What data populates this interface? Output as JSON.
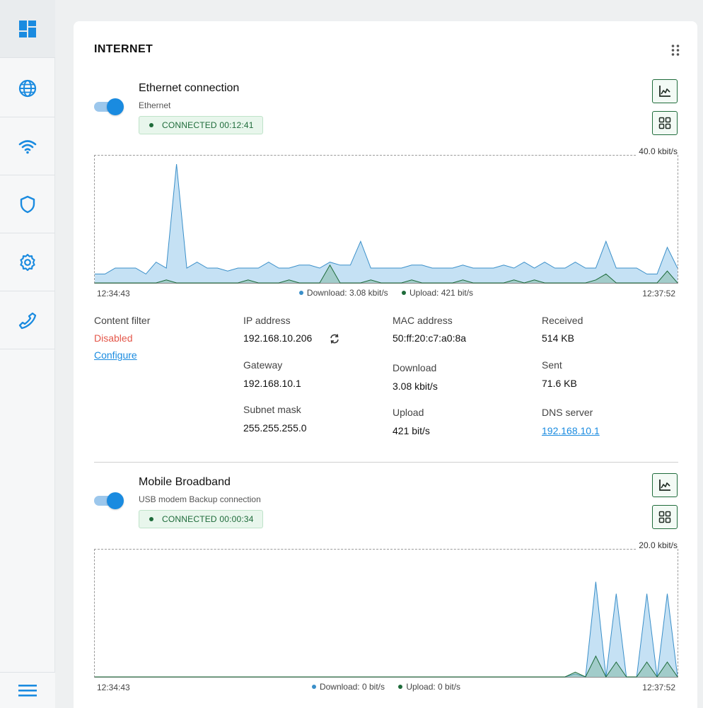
{
  "sidebar": {
    "items": [
      {
        "name": "dashboard-icon"
      },
      {
        "name": "globe-icon"
      },
      {
        "name": "wifi-icon"
      },
      {
        "name": "shield-icon"
      },
      {
        "name": "gear-icon"
      },
      {
        "name": "phone-icon"
      }
    ],
    "menu_icon": "hamburger-icon"
  },
  "card": {
    "title": "INTERNET"
  },
  "ethernet": {
    "name": "Ethernet connection",
    "subtitle": "Ethernet",
    "status": "CONNECTED 00:12:41",
    "enabled": true,
    "graph": {
      "max_label": "40.0 kbit/s",
      "max": 40,
      "start_time": "12:34:43",
      "end_time": "12:37:52",
      "download_legend": "Download: 3.08 kbit/s",
      "upload_legend": "Upload: 421 bit/s",
      "download": [
        3,
        3,
        5,
        5,
        5,
        3,
        7,
        5,
        40,
        5,
        7,
        5,
        5,
        4,
        5,
        5,
        5,
        7,
        5,
        5,
        6,
        6,
        5,
        7,
        6,
        6,
        14,
        5,
        5,
        5,
        5,
        6,
        6,
        5,
        5,
        5,
        6,
        5,
        5,
        5,
        6,
        5,
        7,
        5,
        7,
        5,
        5,
        7,
        5,
        5,
        14,
        5,
        5,
        5,
        3,
        3,
        12,
        5
      ],
      "upload": [
        0,
        0,
        0,
        0,
        0,
        0,
        0,
        1,
        0,
        0,
        0,
        0,
        0,
        0,
        0,
        1,
        0,
        0,
        0,
        1,
        0,
        0,
        0,
        6,
        0,
        0,
        0,
        1,
        0,
        0,
        0,
        1,
        0,
        0,
        0,
        0,
        1,
        0,
        0,
        0,
        0,
        1,
        0,
        1,
        0,
        0,
        0,
        0,
        0,
        1,
        3,
        0,
        0,
        0,
        0,
        0,
        4,
        0
      ]
    },
    "info": {
      "content_filter_label": "Content filter",
      "content_filter_value": "Disabled",
      "configure_link": "Configure",
      "ip_label": "IP address",
      "ip_value": "192.168.10.206",
      "gateway_label": "Gateway",
      "gateway_value": "192.168.10.1",
      "subnet_label": "Subnet mask",
      "subnet_value": "255.255.255.0",
      "mac_label": "MAC address",
      "mac_value": "50:ff:20:c7:a0:8a",
      "download_label": "Download",
      "download_value": "3.08 kbit/s",
      "upload_label": "Upload",
      "upload_value": "421 bit/s",
      "received_label": "Received",
      "received_value": "514 KB",
      "sent_label": "Sent",
      "sent_value": "71.6 KB",
      "dns_label": "DNS server",
      "dns_value": "192.168.10.1"
    }
  },
  "mobile": {
    "name": "Mobile Broadband",
    "subtitle": "USB modem Backup connection",
    "status": "CONNECTED 00:00:34",
    "enabled": true,
    "graph": {
      "max_label": "20.0 kbit/s",
      "max": 20,
      "start_time": "12:34:43",
      "end_time": "12:37:52",
      "download_legend": "Download: 0 bit/s",
      "upload_legend": "Upload: 0 bit/s",
      "download": [
        0,
        0,
        0,
        0,
        0,
        0,
        0,
        0,
        0,
        0,
        0,
        0,
        0,
        0,
        0,
        0,
        0,
        0,
        0,
        0,
        0,
        0,
        0,
        0,
        0,
        0,
        0,
        0,
        0,
        0,
        0,
        0,
        0,
        0,
        0,
        0,
        0,
        0,
        0,
        0,
        0,
        0,
        0,
        0,
        0,
        0,
        0,
        0.5,
        0,
        16,
        0,
        14,
        0,
        0,
        14,
        0,
        14,
        0
      ],
      "upload": [
        0,
        0,
        0,
        0,
        0,
        0,
        0,
        0,
        0,
        0,
        0,
        0,
        0,
        0,
        0,
        0,
        0,
        0,
        0,
        0,
        0,
        0,
        0,
        0,
        0,
        0,
        0,
        0,
        0,
        0,
        0,
        0,
        0,
        0,
        0,
        0,
        0,
        0,
        0,
        0,
        0,
        0,
        0,
        0,
        0,
        0,
        0,
        0.8,
        0,
        3.5,
        0,
        2.5,
        0,
        0,
        2.5,
        0,
        2.5,
        0
      ]
    }
  },
  "colors": {
    "accent": "#1a8be0",
    "download_line": "#3a8fc9",
    "upload_line": "#1e6b3a",
    "status_green": "#1e6b3a",
    "disabled_red": "#e4574a"
  }
}
